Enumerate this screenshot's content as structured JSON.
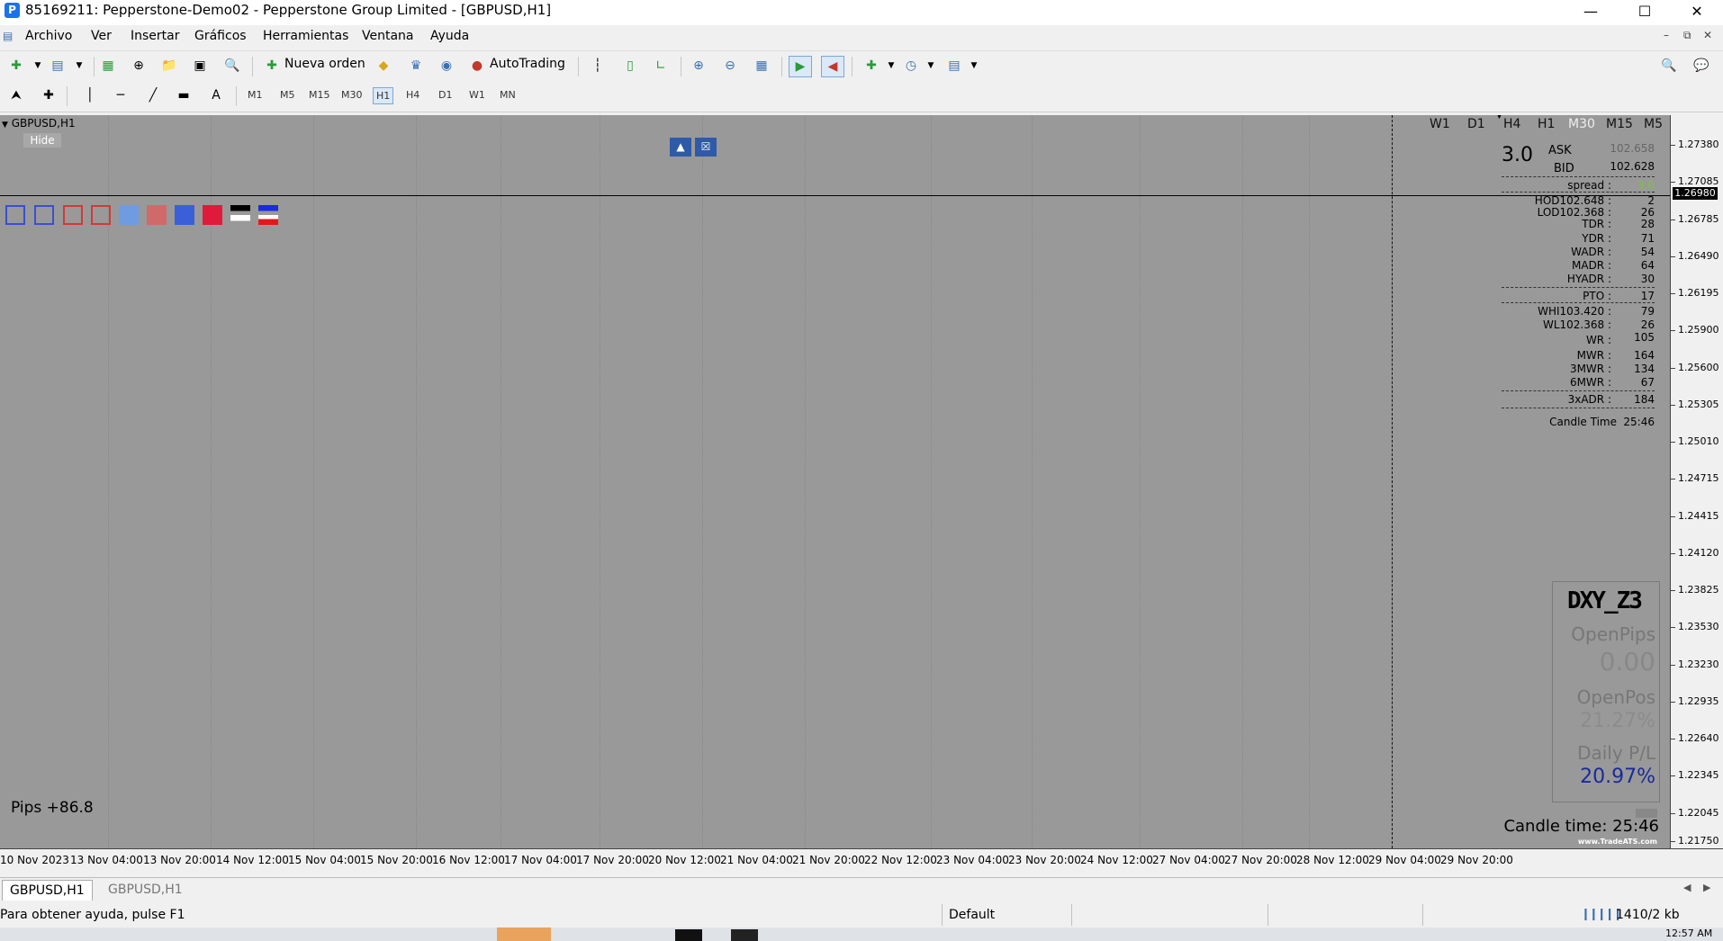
{
  "window": {
    "title": "85169211: Pepperstone-Demo02 - Pepperstone Group Limited - [GBPUSD,H1]"
  },
  "menu": [
    "Archivo",
    "Ver",
    "Insertar",
    "Gráficos",
    "Herramientas",
    "Ventana",
    "Ayuda"
  ],
  "toolbar": {
    "new_order": "Nueva orden",
    "autotrading": "AutoTrading"
  },
  "timeframes": [
    "M1",
    "M5",
    "M15",
    "M30",
    "H1",
    "H4",
    "D1",
    "W1",
    "MN"
  ],
  "active_timeframe": "H1",
  "chart": {
    "symbol": "GBPUSD,H1",
    "hide_label": "Hide",
    "tf_row": [
      "W1",
      "D1",
      "H4",
      "H1",
      "M30",
      "M15",
      "M5"
    ],
    "pips": "Pips +86.8",
    "candle_time": "Candle time: 25:46",
    "watermark": "www.TradeATS.com"
  },
  "info_panel": {
    "spread_big": "3.0",
    "ask_label": "ASK",
    "ask_value": "102.658",
    "bid_label": "BID",
    "bid_value": "102.628",
    "spread_label": "spread :",
    "spread_value": "3.0",
    "hod": "HOD102.648 :",
    "hod_v": "2",
    "lod": "LOD102.368 :",
    "lod_v": "26",
    "tdr": "TDR :",
    "tdr_v": "28",
    "ydr": "YDR :",
    "ydr_v": "71",
    "wadr": "WADR :",
    "wadr_v": "54",
    "madr": "MADR :",
    "madr_v": "64",
    "hyadr": "HYADR :",
    "hyadr_v": "30",
    "pto": "PTO :",
    "pto_v": "17",
    "whi": "WHI103.420 :",
    "whi_v": "79",
    "wlo": "WL102.368 :",
    "wlo_v": "26",
    "wr": "WR :",
    "wr_v": "105",
    "mwr": "MWR :",
    "mwr_v": "164",
    "mwr3": "3MWR :",
    "mwr3_v": "134",
    "mwr6": "6MWR :",
    "mwr6_v": "67",
    "adr3": "3xADR :",
    "adr3_v": "184",
    "candle_label": "Candle Time",
    "candle_v": "25:46"
  },
  "dxy": {
    "title": "DXY_Z3",
    "open_pips_label": "OpenPips",
    "open_pips": "0.00",
    "open_pos_label": "OpenPos",
    "open_pos": "21.27%",
    "daily_label": "Daily P/L",
    "daily": "20.97%"
  },
  "price_axis": [
    "1.27380",
    "1.27085",
    "1.26980",
    "1.26785",
    "1.26490",
    "1.26195",
    "1.25900",
    "1.25600",
    "1.25305",
    "1.25010",
    "1.24715",
    "1.24415",
    "1.24120",
    "1.23825",
    "1.23530",
    "1.23230",
    "1.22935",
    "1.22640",
    "1.22345",
    "1.22045",
    "1.21750"
  ],
  "current_price": "1.26980",
  "time_axis": [
    "10 Nov 2023",
    "13 Nov 04:00",
    "13 Nov 20:00",
    "14 Nov 12:00",
    "15 Nov 04:00",
    "15 Nov 20:00",
    "16 Nov 12:00",
    "17 Nov 04:00",
    "17 Nov 20:00",
    "20 Nov 12:00",
    "21 Nov 04:00",
    "21 Nov 20:00",
    "22 Nov 12:00",
    "23 Nov 04:00",
    "23 Nov 20:00",
    "24 Nov 12:00",
    "27 Nov 04:00",
    "27 Nov 20:00",
    "28 Nov 12:00",
    "29 Nov 04:00",
    "29 Nov 20:00"
  ],
  "tabs": [
    "GBPUSD,H1",
    "GBPUSD,H1"
  ],
  "status": {
    "help": "Para obtener ayuda, pulse F1",
    "profile": "Default",
    "traffic": "1410/2 kb",
    "clock": "12:57 AM"
  },
  "colors": {
    "chart_bg": "#999999",
    "accent": "#2f5aa8",
    "dxy_value": "#1a2a9a"
  }
}
